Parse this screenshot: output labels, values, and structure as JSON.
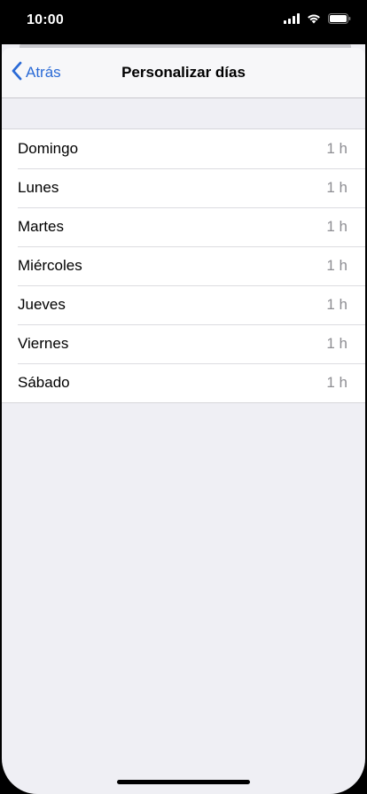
{
  "status_bar": {
    "time": "10:00",
    "icons": [
      "cellular-signal-icon",
      "wifi-icon",
      "battery-icon"
    ]
  },
  "nav": {
    "back_label": "Atrás",
    "title": "Personalizar días"
  },
  "days": [
    {
      "label": "Domingo",
      "value": "1 h"
    },
    {
      "label": "Lunes",
      "value": "1 h"
    },
    {
      "label": "Martes",
      "value": "1 h"
    },
    {
      "label": "Miércoles",
      "value": "1 h"
    },
    {
      "label": "Jueves",
      "value": "1 h"
    },
    {
      "label": "Viernes",
      "value": "1 h"
    },
    {
      "label": "Sábado",
      "value": "1 h"
    }
  ],
  "colors": {
    "accent": "#2a6ad6",
    "background": "#efeff4",
    "secondary_text": "#8e8e93"
  }
}
